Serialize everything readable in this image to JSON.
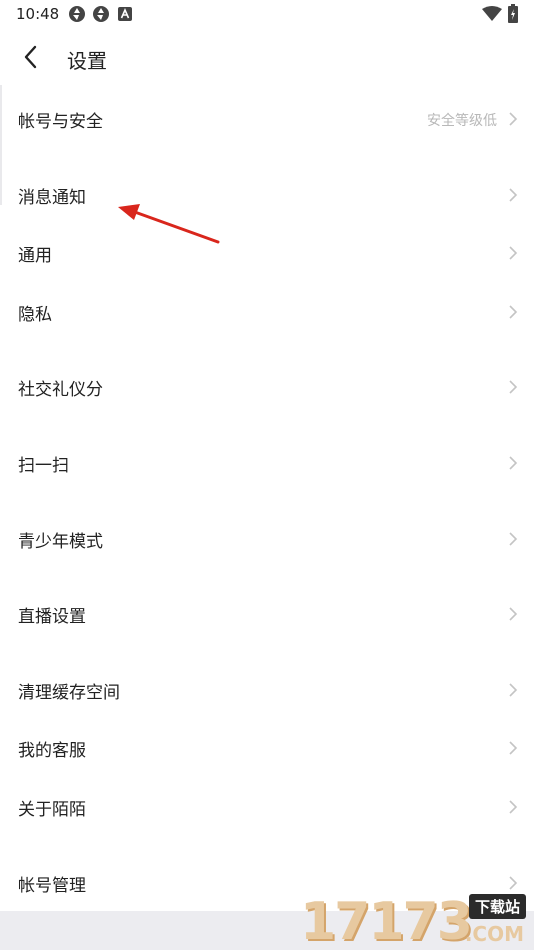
{
  "status_bar": {
    "time": "10:48",
    "left_icons": [
      "aperture-icon",
      "aperture-icon",
      "app-a-icon"
    ],
    "right_icons": [
      "wifi-icon",
      "battery-charging-icon"
    ]
  },
  "header": {
    "title": "设置"
  },
  "settings": [
    {
      "name": "account-security",
      "label": "帐号与安全",
      "hint": "安全等级低"
    },
    {
      "name": "notifications",
      "label": "消息通知"
    },
    {
      "name": "general",
      "label": "通用"
    },
    {
      "name": "privacy",
      "label": "隐私"
    },
    {
      "name": "social-etiquette-score",
      "label": "社交礼仪分"
    },
    {
      "name": "scan",
      "label": "扫一扫"
    },
    {
      "name": "teen-mode",
      "label": "青少年模式"
    },
    {
      "name": "live-settings",
      "label": "直播设置"
    },
    {
      "name": "clear-cache",
      "label": "清理缓存空间"
    },
    {
      "name": "customer-service",
      "label": "我的客服"
    },
    {
      "name": "about",
      "label": "关于陌陌"
    },
    {
      "name": "account-management",
      "label": "帐号管理"
    }
  ],
  "annotation": {
    "arrow_color": "#d9261c"
  },
  "watermark": {
    "digits": "17173",
    "tag": "下载站",
    "suffix": ".COM"
  },
  "colors": {
    "hint": "#b8b8b8",
    "chevron": "#c4c4c4",
    "text": "#222222"
  }
}
